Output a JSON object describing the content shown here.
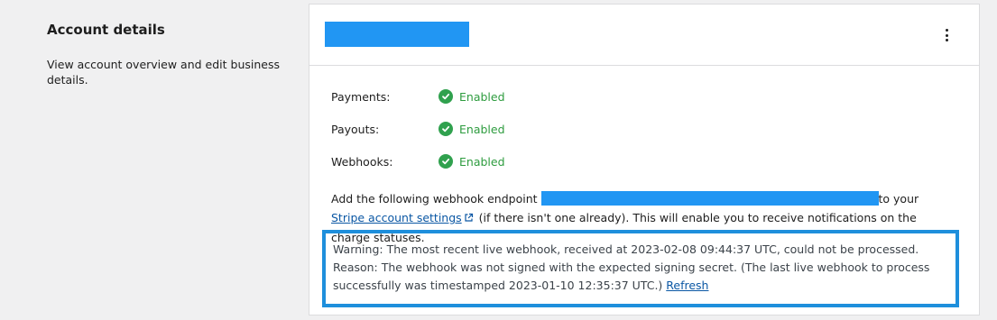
{
  "section": {
    "title": "Account details",
    "description": "View account overview and edit business details."
  },
  "statuses": [
    {
      "label": "Payments:",
      "value": "Enabled"
    },
    {
      "label": "Payouts:",
      "value": "Enabled"
    },
    {
      "label": "Webhooks:",
      "value": "Enabled"
    }
  ],
  "webhook": {
    "intro": "Add the following webhook endpoint ",
    "to_your": "to your ",
    "link_label": "Stripe account settings",
    "outro": " (if there isn't one already). This will enable you to receive notifications on the charge statuses."
  },
  "warning": {
    "text": "Warning: The most recent live webhook, received at 2023-02-08 09:44:37 UTC, could not be processed. Reason: The webhook was not signed with the expected signing secret. (The last live webhook to process successfully was timestamped 2023-01-10 12:35:37 UTC.) ",
    "refresh_label": "Refresh"
  },
  "colors": {
    "redaction": "#2196f3",
    "enabled": "#2e9c3f",
    "highlight_border": "#1e8fdc",
    "link": "#0a57a4"
  },
  "icons": {
    "status": "check-circle-icon",
    "menu": "more-vertical-icon",
    "external": "external-link-icon"
  }
}
